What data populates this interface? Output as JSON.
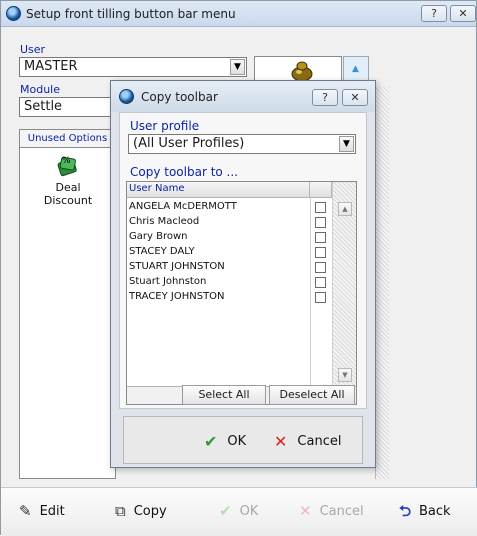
{
  "window": {
    "title": "Setup front tilling button bar menu",
    "help_btn": "?",
    "close_btn": "✕"
  },
  "user": {
    "label": "User",
    "value": "MASTER"
  },
  "module": {
    "label": "Module",
    "value": "Settle"
  },
  "unused_options": {
    "header": "Unused Options",
    "items": [
      {
        "label": "Deal Discount",
        "icon": "deal-discount-icon"
      }
    ]
  },
  "preview": {
    "icon": "money-bag-icon"
  },
  "toolbar": {
    "edit": "Edit",
    "copy": "Copy",
    "ok": "OK",
    "cancel": "Cancel",
    "back": "Back"
  },
  "dialog": {
    "title": "Copy toolbar",
    "help_btn": "?",
    "close_btn": "✕",
    "user_profile_label": "User profile",
    "user_profile_value": "(All User Profiles)",
    "copy_to_label": "Copy toolbar to ...",
    "column_header": "User Name",
    "users": [
      "ANGELA McDERMOTT",
      "Chris Macleod",
      "Gary Brown",
      "STACEY DALY",
      "STUART JOHNSTON",
      "Stuart Johnston",
      "TRACEY JOHNSTON"
    ],
    "select_all": "Select All",
    "deselect_all": "Deselect All",
    "ok": "OK",
    "cancel": "Cancel"
  },
  "colors": {
    "label_blue": "#0a24a8",
    "ok_green": "#2e9e2e",
    "cancel_red": "#e02020",
    "back_blue": "#1f3fbf"
  }
}
